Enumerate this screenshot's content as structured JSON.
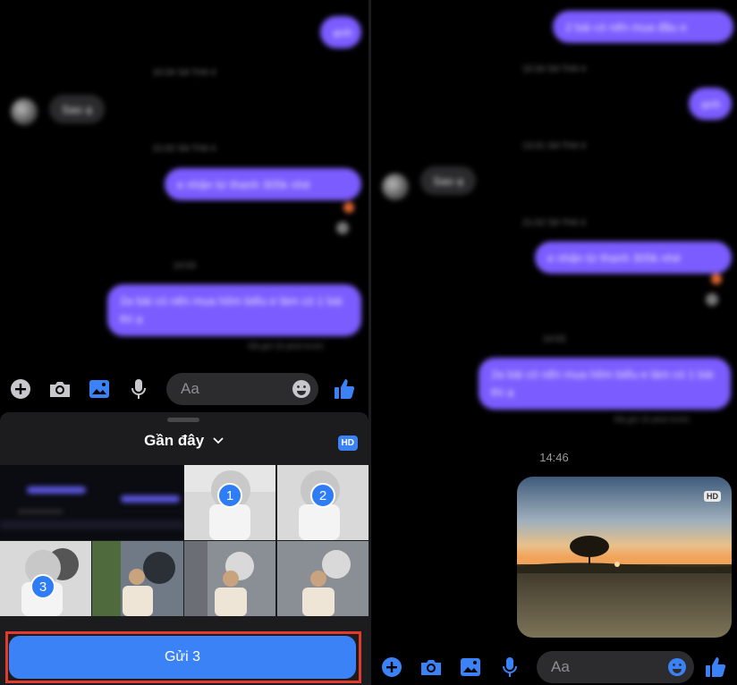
{
  "left_chat": {
    "messages_out": [
      "ạnh",
      "e nhận từ thanh 305k nhé",
      "2a bài có nến mua hôm biếu e làm có 1 bài thì ạ"
    ],
    "messages_in": [
      "Sao ạ"
    ],
    "timestamps": [
      "10:34 SA TH4 4",
      "21:02 SA TH4 4",
      "14:03"
    ],
    "seen": "Đã gửi 15 phút trước"
  },
  "composer": {
    "placeholder": "Aa"
  },
  "picker": {
    "title": "Gần đây",
    "hd_badge": "HD",
    "selections": [
      "1",
      "2",
      "3"
    ],
    "send_label": "Gửi 3"
  },
  "right_chat": {
    "messages_out": [
      "2 bài có nến mua đầu e",
      "ạnh",
      "e nhận từ thanh 305k nhé",
      "2a bài có nến mua hôm biếu e làm có 1 bài thì ạ"
    ],
    "messages_in": [
      "Sao ạ"
    ],
    "timestamps": [
      "10:34 SA TH4 4",
      "13:41 SA TH4 4",
      "21:02 SA TH4 4",
      "14:03"
    ],
    "seen": "Đã gửi 15 phút trước",
    "photo_time": "14:46",
    "photo_hd": "HD",
    "composer_placeholder": "Aa"
  },
  "colors": {
    "accent": "#3b82f6",
    "bubble_out": "#7b5cff",
    "highlight_box": "#e23b2e"
  },
  "icons": [
    "plus-icon",
    "camera-icon",
    "image-icon",
    "microphone-icon",
    "emoji-icon",
    "thumbs-up-icon",
    "chevron-down-icon"
  ]
}
